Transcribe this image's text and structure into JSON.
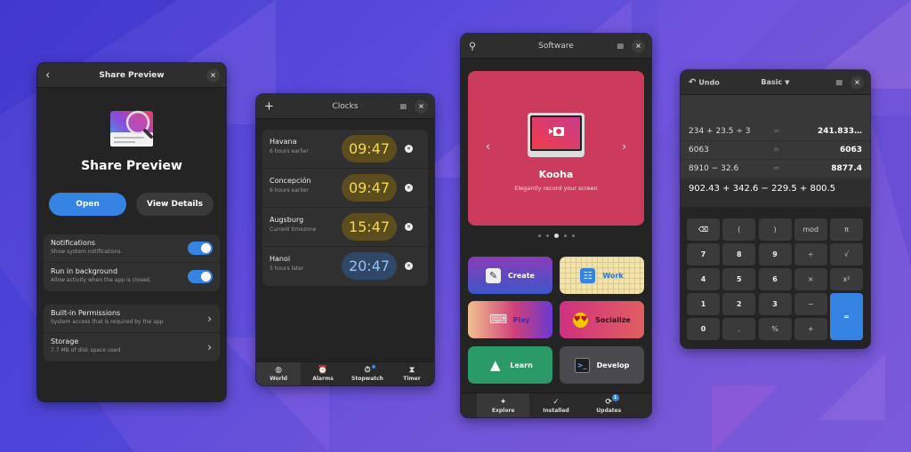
{
  "colors": {
    "accent": "#3584e4",
    "window_bg": "#242424",
    "clock_day": "#f5d957",
    "clock_night": "#99c1f1",
    "hero_bg": "#cc3b5c"
  },
  "share_preview": {
    "title": "Share Preview",
    "back_icon": "chevron-left-icon",
    "close_icon": "close-icon",
    "app_name": "Share Preview",
    "open_label": "Open",
    "details_label": "View Details",
    "settings": [
      {
        "title": "Notifications",
        "subtitle": "Show system notifications.",
        "enabled": true
      },
      {
        "title": "Run in background",
        "subtitle": "Allow activity when the app is closed.",
        "enabled": true
      }
    ],
    "links": [
      {
        "title": "Built-in Permissions",
        "subtitle": "System access that is required by the app"
      },
      {
        "title": "Storage",
        "subtitle": "7.7 MB of disk space used"
      }
    ]
  },
  "clocks": {
    "title": "Clocks",
    "add_icon": "plus-icon",
    "menu_icon": "hamburger-icon",
    "items": [
      {
        "city": "Havana",
        "offset": "6 hours earlier",
        "time": "09:47",
        "period": "day"
      },
      {
        "city": "Concepción",
        "offset": "6 hours earlier",
        "time": "09:47",
        "period": "day"
      },
      {
        "city": "Augsburg",
        "offset": "Current timezone",
        "time": "15:47",
        "period": "day"
      },
      {
        "city": "Hanoi",
        "offset": "5 hours later",
        "time": "20:47",
        "period": "night"
      }
    ],
    "nav": [
      {
        "label": "World",
        "icon": "globe-icon",
        "glyph": "◍",
        "active": true
      },
      {
        "label": "Alarms",
        "icon": "alarm-icon",
        "glyph": "⏰",
        "active": false
      },
      {
        "label": "Stopwatch",
        "icon": "stopwatch-icon",
        "glyph": "⏱",
        "active": false,
        "indicator": true
      },
      {
        "label": "Timer",
        "icon": "hourglass-icon",
        "glyph": "⧗",
        "active": false
      }
    ]
  },
  "software": {
    "title": "Software",
    "search_icon": "search-icon",
    "featured": {
      "name": "Kooha",
      "description": "Elegantly record your screen",
      "page_index": 2,
      "page_count": 5
    },
    "categories": [
      {
        "label": "Create",
        "icon": "paint-icon",
        "glyph": "🖌"
      },
      {
        "label": "Work",
        "icon": "checklist-icon",
        "glyph": "☷"
      },
      {
        "label": "Play",
        "icon": "gamepad-icon",
        "glyph": "🎮"
      },
      {
        "label": "Socialize",
        "icon": "emoji-icon",
        "glyph": "😍"
      },
      {
        "label": "Learn",
        "icon": "sail-icon",
        "glyph": "▲"
      },
      {
        "label": "Develop",
        "icon": "terminal-icon",
        "glyph": "▤"
      }
    ],
    "nav": [
      {
        "label": "Explore",
        "icon": "explore-icon",
        "glyph": "✦",
        "active": true
      },
      {
        "label": "Installed",
        "icon": "check-circle-icon",
        "glyph": "✓",
        "active": false
      },
      {
        "label": "Updates",
        "icon": "refresh-icon",
        "glyph": "⟳",
        "active": false,
        "badge": "1"
      }
    ]
  },
  "calculator": {
    "undo_label": "Undo",
    "mode_label": "Basic",
    "history": [
      {
        "expr": "234 + 23.5 ÷ 3",
        "eq": "=",
        "result": "241.833…"
      },
      {
        "expr": "6063",
        "eq": "=",
        "result": "6063"
      },
      {
        "expr": "8910 − 32.6",
        "eq": "=",
        "result": "8877.4"
      }
    ],
    "current_input": "902.43 + 342.6 − 229.5 + 800.5",
    "keys": [
      "⌫",
      "(",
      ")",
      "mod",
      "π",
      "7",
      "8",
      "9",
      "÷",
      "√",
      "4",
      "5",
      "6",
      "×",
      "x²",
      "1",
      "2",
      "3",
      "−",
      "=",
      "0",
      ".",
      "%",
      "+"
    ]
  }
}
